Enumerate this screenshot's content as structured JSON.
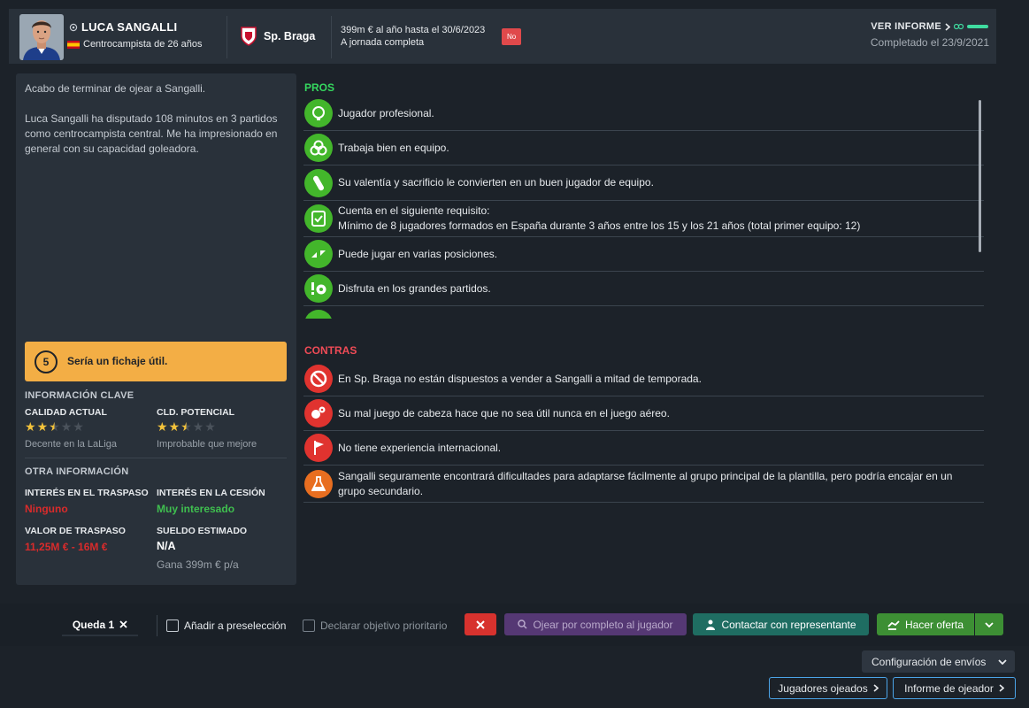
{
  "player": {
    "name": "LUCA SANGALLI",
    "subtitle": "Centrocampista de 26 años"
  },
  "club": {
    "name": "Sp. Braga"
  },
  "contract": {
    "line1": "399m € al año hasta el 30/6/2023",
    "line2": "A jornada completa",
    "badge": "No"
  },
  "report": {
    "link": "VER INFORME",
    "completed": "Completado el 23/9/2021"
  },
  "summary": {
    "p1": "Acabo de terminar de ojear a Sangalli.",
    "p2": "Luca Sangalli ha disputado 108 minutos en 3 partidos como centrocampista central. Me ha impresionado en general con su capacidad goleadora."
  },
  "recommendation": {
    "score": "5",
    "text": "Sería un fichaje útil."
  },
  "key_info": {
    "title": "INFORMACIÓN CLAVE",
    "current_label": "CALIDAD ACTUAL",
    "current_stars": 2.5,
    "current_note": "Decente en la LaLiga",
    "potential_label": "CLD. POTENCIAL",
    "potential_stars": 2.5,
    "potential_note": "Improbable que mejore"
  },
  "other_info": {
    "title": "OTRA INFORMACIÓN",
    "transfer_interest_label": "INTERÉS EN EL TRASPASO",
    "transfer_interest": "Ninguno",
    "loan_interest_label": "INTERÉS EN LA CESIÓN",
    "loan_interest": "Muy interesado",
    "transfer_value_label": "VALOR DE TRASPASO",
    "transfer_value": "11,25M € - 16M €",
    "wage_label": "SUELDO ESTIMADO",
    "wage": "N/A",
    "wage_note": "Gana 399m € p/a"
  },
  "pros": {
    "title": "PROS",
    "items": [
      {
        "text": "Jugador profesional.",
        "icon": "brain-icon"
      },
      {
        "text": "Trabaja bien en equipo.",
        "icon": "team-rings-icon"
      },
      {
        "text": "Su valentía y sacrificio le convierten en un buen jugador de equipo.",
        "icon": "bandage-icon"
      },
      {
        "text": "Cuenta en el siguiente requisito:",
        "text2": "Mínimo de 8 jugadores formados en España durante 3 años entre los 15 y los 21 años (total primer equipo: 12)",
        "icon": "checklist-icon"
      },
      {
        "text": "Puede jugar en varias posiciones.",
        "icon": "positions-icon"
      },
      {
        "text": "Disfruta en los grandes partidos.",
        "icon": "big-match-icon"
      }
    ]
  },
  "cons": {
    "title": "CONTRAS",
    "items": [
      {
        "text": "En Sp. Braga no están dispuestos a vender a Sangalli a mitad de temporada.",
        "icon": "no-entry-icon"
      },
      {
        "text": "Su mal juego de cabeza hace que no sea útil nunca en el juego aéreo.",
        "icon": "heading-icon"
      },
      {
        "text": "No tiene experiencia internacional.",
        "icon": "flag-icon"
      },
      {
        "text": "Sangalli seguramente encontrará dificultades para adaptarse fácilmente al grupo principal de la plantilla, pero podría encajar en un grupo secundario.",
        "icon": "flask-icon"
      }
    ]
  },
  "actions": {
    "remaining": "Queda 1",
    "shortlist": "Añadir a preselección",
    "priority": "Declarar objetivo prioritario",
    "scout_full": "Ojear por completo al jugador",
    "contact_agent": "Contactar con representante",
    "make_offer": "Hacer oferta",
    "send_config": "Configuración de envíos",
    "scouted_players": "Jugadores ojeados",
    "scout_report": "Informe de ojeador"
  },
  "colors": {
    "pros": "#35d85f",
    "cons": "#ef4b56",
    "recommendation": "#f3ae45",
    "offer": "#3d8f34",
    "contact": "#1f6d62",
    "scout": "#5a3a7a"
  }
}
